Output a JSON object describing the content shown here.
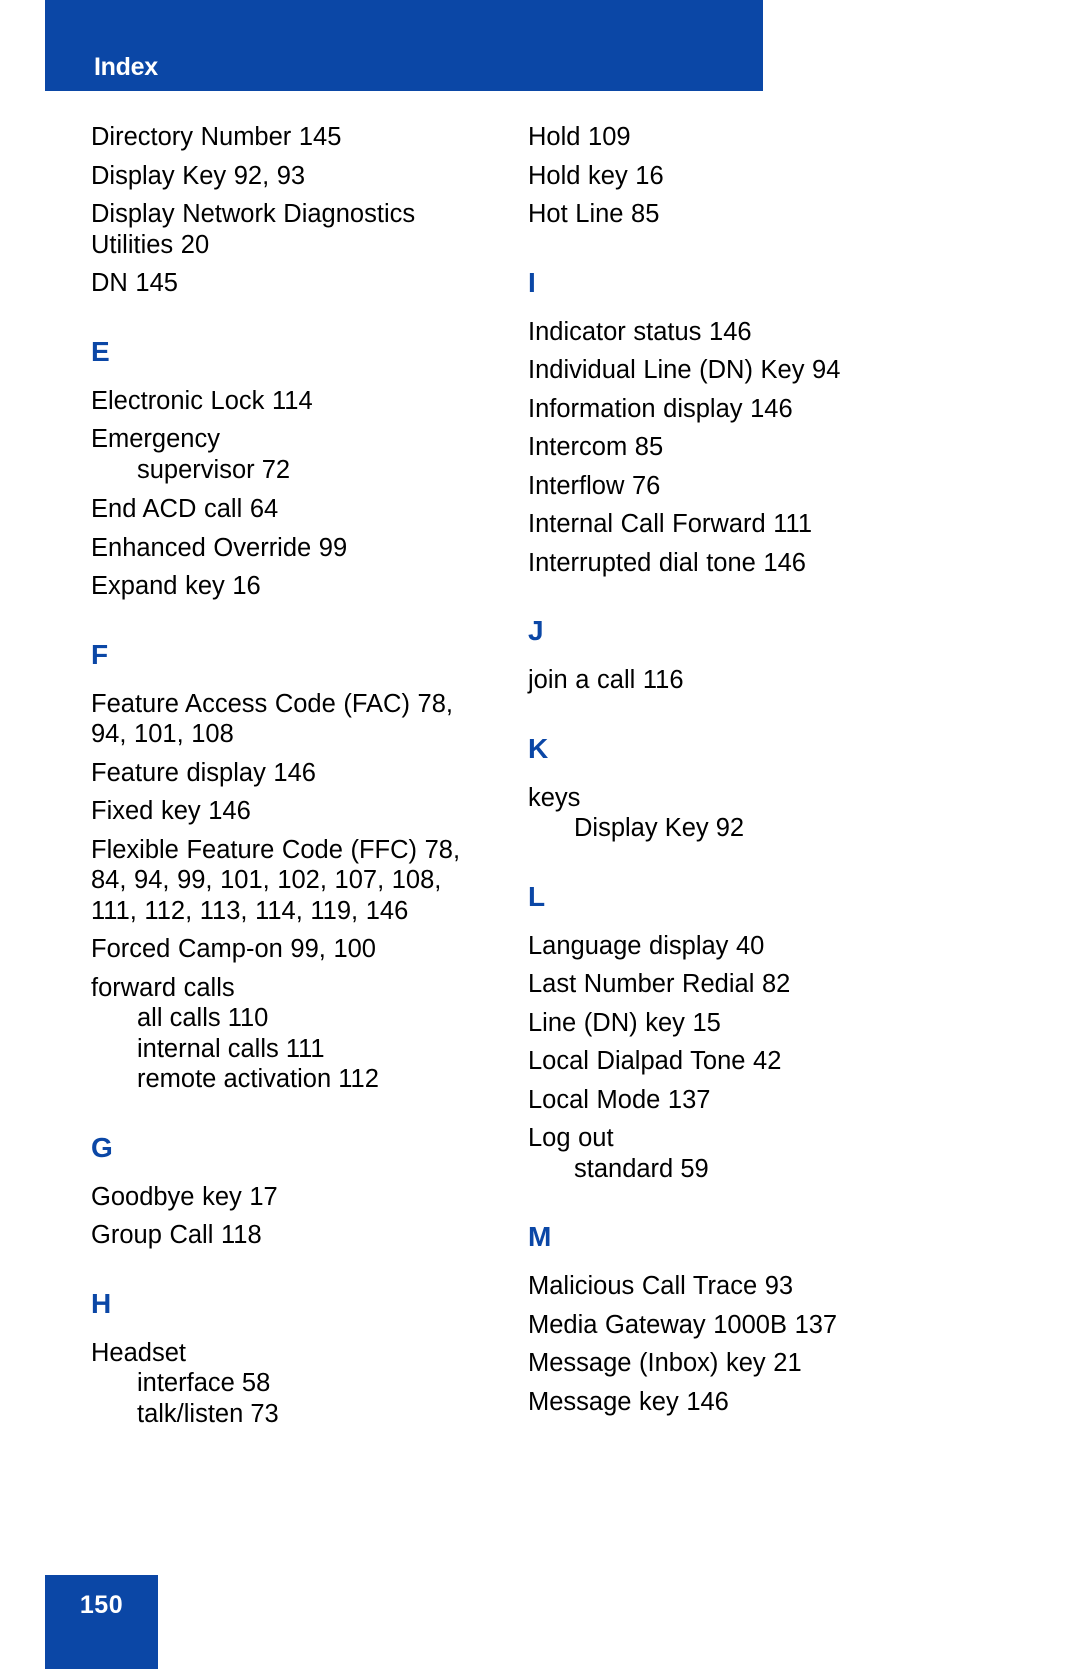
{
  "header": {
    "title": "Index"
  },
  "footer": {
    "page_number": "150"
  },
  "colors": {
    "brand_blue": "#0B47A6",
    "text_black": "#000000",
    "page_background": "#FFFFFF"
  },
  "columns": {
    "left": [
      {
        "kind": "entry",
        "text": "Directory Number 145"
      },
      {
        "kind": "entry",
        "text": "Display Key 92, 93"
      },
      {
        "kind": "entry",
        "text": "Display Network Diagnostics Utilities 20"
      },
      {
        "kind": "entry",
        "text": "DN 145"
      },
      {
        "kind": "letter",
        "text": "E"
      },
      {
        "kind": "entry",
        "text": "Electronic Lock 114"
      },
      {
        "kind": "entry",
        "text": "Emergency"
      },
      {
        "kind": "sub",
        "text": "supervisor 72"
      },
      {
        "kind": "entry",
        "text": "End ACD call 64"
      },
      {
        "kind": "entry",
        "text": "Enhanced Override 99"
      },
      {
        "kind": "entry",
        "text": "Expand key 16"
      },
      {
        "kind": "letter",
        "text": "F"
      },
      {
        "kind": "entry",
        "text": "Feature Access Code (FAC) 78, 94, 101, 108"
      },
      {
        "kind": "entry",
        "text": "Feature display 146"
      },
      {
        "kind": "entry",
        "text": "Fixed key 146"
      },
      {
        "kind": "entry",
        "text": "Flexible Feature Code (FFC) 78, 84, 94, 99, 101, 102, 107, 108, 111, 112, 113, 114, 119, 146"
      },
      {
        "kind": "entry",
        "text": "Forced Camp-on 99, 100"
      },
      {
        "kind": "entry",
        "text": "forward calls"
      },
      {
        "kind": "sub",
        "text": "all calls 110"
      },
      {
        "kind": "sub",
        "text": "internal calls 111"
      },
      {
        "kind": "sub",
        "text": "remote activation 112"
      },
      {
        "kind": "letter",
        "text": "G"
      },
      {
        "kind": "entry",
        "text": "Goodbye key 17"
      },
      {
        "kind": "entry",
        "text": "Group Call 118"
      },
      {
        "kind": "letter",
        "text": "H"
      },
      {
        "kind": "entry",
        "text": "Headset"
      },
      {
        "kind": "sub",
        "text": "interface 58"
      },
      {
        "kind": "sub",
        "text": "talk/listen 73"
      }
    ],
    "right": [
      {
        "kind": "entry",
        "text": "Hold 109"
      },
      {
        "kind": "entry",
        "text": "Hold key 16"
      },
      {
        "kind": "entry",
        "text": "Hot Line 85"
      },
      {
        "kind": "letter",
        "text": "I"
      },
      {
        "kind": "entry",
        "text": "Indicator status 146"
      },
      {
        "kind": "entry",
        "text": "Individual Line (DN) Key 94"
      },
      {
        "kind": "entry",
        "text": "Information display 146"
      },
      {
        "kind": "entry",
        "text": "Intercom 85"
      },
      {
        "kind": "entry",
        "text": "Interflow 76"
      },
      {
        "kind": "entry",
        "text": "Internal Call Forward 111"
      },
      {
        "kind": "entry",
        "text": "Interrupted dial tone 146"
      },
      {
        "kind": "letter",
        "text": "J"
      },
      {
        "kind": "entry",
        "text": "join a call 116"
      },
      {
        "kind": "letter",
        "text": "K"
      },
      {
        "kind": "entry",
        "text": "keys"
      },
      {
        "kind": "sub",
        "text": "Display Key 92"
      },
      {
        "kind": "letter",
        "text": "L"
      },
      {
        "kind": "entry",
        "text": "Language display 40"
      },
      {
        "kind": "entry",
        "text": "Last Number Redial 82"
      },
      {
        "kind": "entry",
        "text": "Line (DN) key 15"
      },
      {
        "kind": "entry",
        "text": "Local Dialpad Tone 42"
      },
      {
        "kind": "entry",
        "text": "Local Mode 137"
      },
      {
        "kind": "entry",
        "text": "Log out"
      },
      {
        "kind": "sub",
        "text": "standard 59"
      },
      {
        "kind": "letter",
        "text": "M"
      },
      {
        "kind": "entry",
        "text": "Malicious Call Trace 93"
      },
      {
        "kind": "entry",
        "text": "Media Gateway 1000B 137"
      },
      {
        "kind": "entry",
        "text": "Message (Inbox) key 21"
      },
      {
        "kind": "entry",
        "text": "Message key 146"
      }
    ]
  }
}
